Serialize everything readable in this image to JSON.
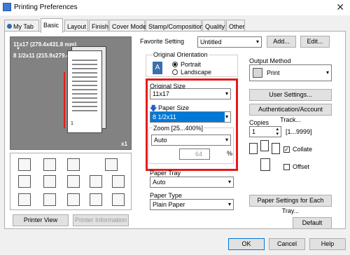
{
  "window": {
    "title": "Printing Preferences",
    "close_glyph": "✕"
  },
  "tabs": [
    "My Tab",
    "Basic",
    "Layout",
    "Finish",
    "Cover Mode",
    "Stamp/Composition",
    "Quality",
    "Other"
  ],
  "favorite": {
    "label": "Favorite Setting",
    "value": "Untitled",
    "add": "Add...",
    "edit": "Edit..."
  },
  "preview": {
    "size1": "11x17 (279.4x431.8 mm)",
    "size2": "8 1/2x11 (215.9x279.4 mm)",
    "copies_badge": "x1",
    "page_number": "1",
    "arrow": "▼"
  },
  "orientation": {
    "group_label": "Original Orientation",
    "portrait": "Portrait",
    "landscape": "Landscape",
    "selected": "Portrait"
  },
  "original_size": {
    "label": "Original Size",
    "value": "11x17"
  },
  "paper_size": {
    "label": "Paper Size",
    "value": "8 1/2x11"
  },
  "zoom": {
    "label": "Zoom [25...400%]",
    "mode": "Auto",
    "percent": "64",
    "unit": "%"
  },
  "paper_tray": {
    "label": "Paper Tray",
    "value": "Auto"
  },
  "paper_type": {
    "label": "Paper Type",
    "value": "Plain Paper"
  },
  "output_method": {
    "label": "Output Method",
    "value": "Print"
  },
  "user_settings": "User Settings...",
  "auth_tracking": "Authentication/Account Track...",
  "copies": {
    "label": "Copies",
    "value": "1",
    "range": "[1...9999]"
  },
  "collate": {
    "label": "Collate",
    "checked": true
  },
  "offset": {
    "label": "Offset",
    "checked": false
  },
  "paper_settings_tray": "Paper Settings for Each Tray...",
  "printer_view": "Printer View",
  "printer_info": "Printer Information",
  "default": "Default",
  "footer": {
    "ok": "OK",
    "cancel": "Cancel",
    "help": "Help"
  },
  "colors": {
    "highlight": "#e31b1b",
    "selection": "#0078d7"
  }
}
